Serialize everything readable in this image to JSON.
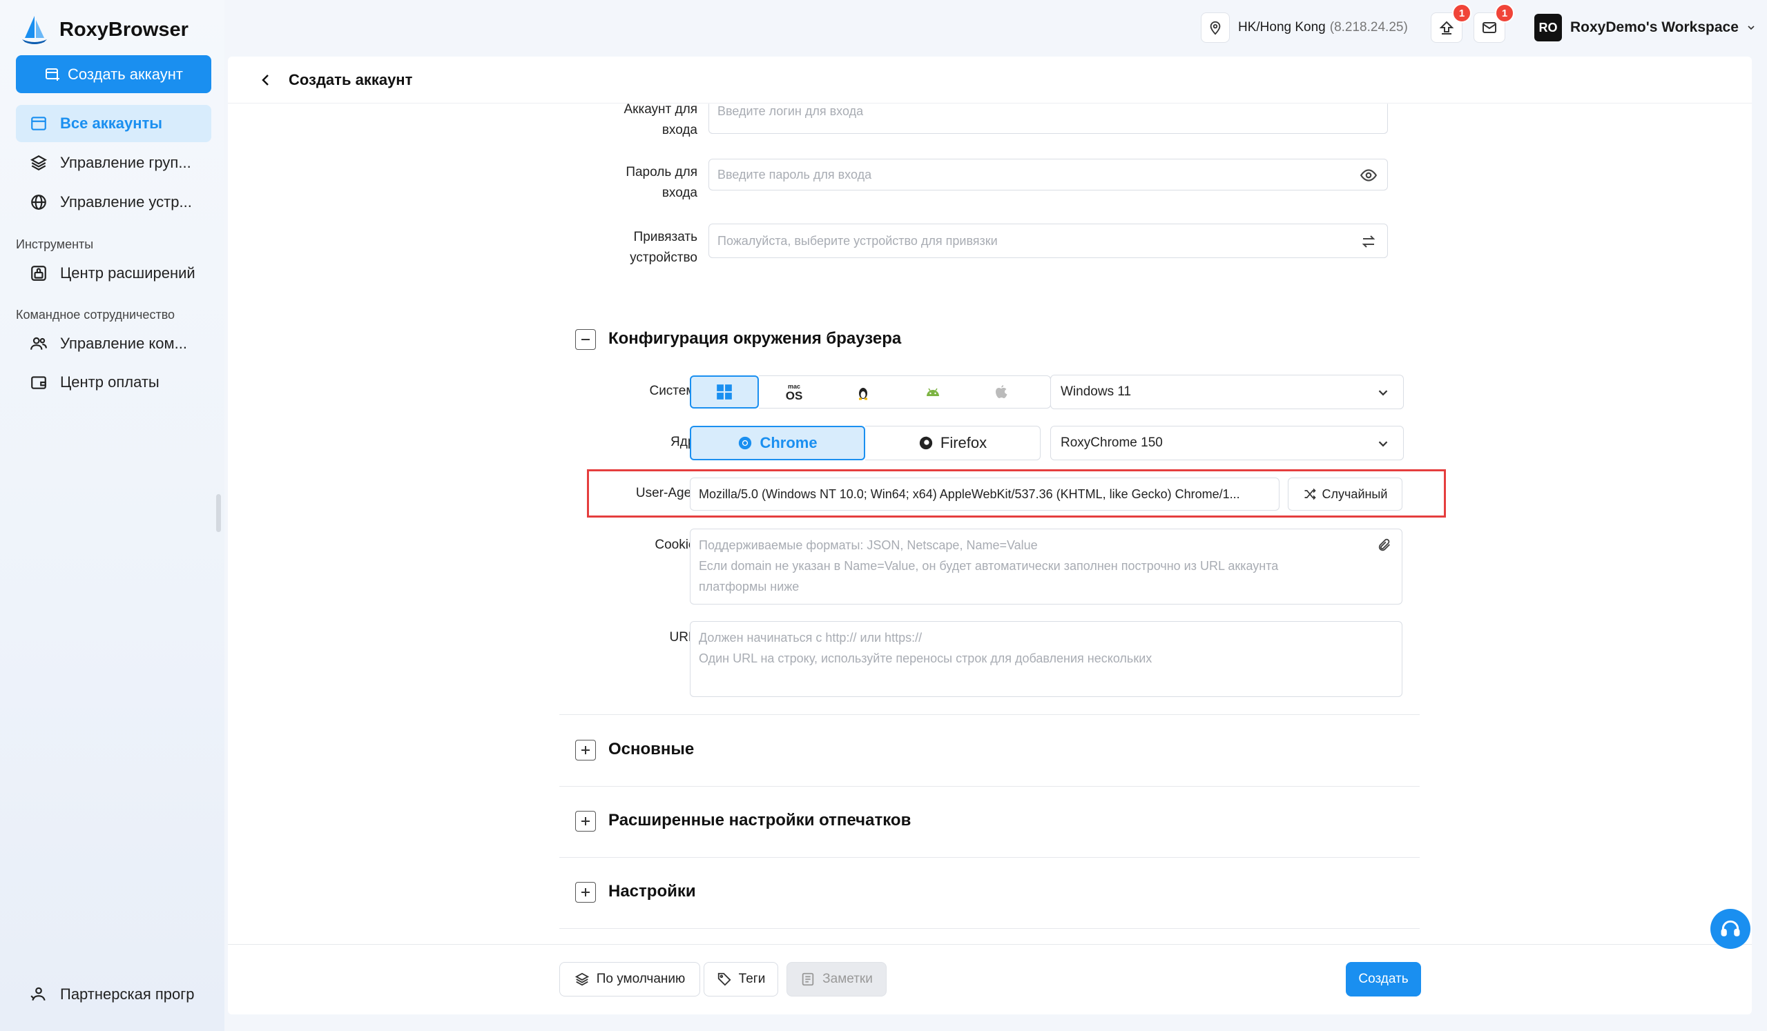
{
  "app": {
    "name": "RoxyBrowser"
  },
  "sidebar": {
    "create_button": "Создать аккаунт",
    "items": [
      {
        "label": "Все аккаунты"
      },
      {
        "label": "Управление груп..."
      },
      {
        "label": "Управление устр..."
      }
    ],
    "tools_section": "Инструменты",
    "tools_items": [
      {
        "label": "Центр расширений"
      }
    ],
    "team_section": "Командное сотрудничество",
    "team_items": [
      {
        "label": "Управление ком..."
      },
      {
        "label": "Центр оплаты"
      }
    ],
    "partner": "Партнерская прогр"
  },
  "topbar": {
    "location": "HK/Hong Kong",
    "ip": "(8.218.24.25)",
    "upload_badge": "1",
    "mail_badge": "1",
    "workspace_avatar": "RO",
    "workspace": "RoxyDemo's Workspace"
  },
  "page": {
    "title": "Создать аккаунт",
    "login_label_1": "Аккаунт для",
    "login_label_2": "входа",
    "login_placeholder": "Введите логин для входа",
    "password_label_1": "Пароль для",
    "password_label_2": "входа",
    "password_placeholder": "Введите пароль для входа",
    "device_label_1": "Привязать",
    "device_label_2": "устройство",
    "device_placeholder": "Пожалуйста, выберите устройство для привязки",
    "env_section": "Конфигурация окружения браузера",
    "system_label": "Система",
    "system_select": "Windows 11",
    "kernel_label": "Ядро",
    "kernel_chrome": "Chrome",
    "kernel_firefox": "Firefox",
    "kernel_select": "RoxyChrome 150",
    "ua_label": "User-Agent",
    "ua_value": "Mozilla/5.0 (Windows NT 10.0; Win64; x64) AppleWebKit/537.36 (KHTML, like Gecko) Chrome/1...",
    "ua_random": "Случайный",
    "cookies_label": "Cookies",
    "cookies_ph1": "Поддерживаемые форматы: JSON, Netscape, Name=Value",
    "cookies_ph2": "Если domain не указан в Name=Value, он будет автоматически заполнен построчно из URL аккаунта",
    "cookies_ph3": "платформы ниже",
    "urls_label": "URLs",
    "urls_ph1": "Должен начинаться с http:// или https://",
    "urls_ph2": "Один URL на строку, используйте переносы строк для добавления нескольких",
    "section_basic": "Основные",
    "section_fingerprint": "Расширенные настройки отпечатков",
    "section_settings": "Настройки"
  },
  "footer": {
    "default_button": "По умолчанию",
    "tags_button": "Теги",
    "notes_button": "Заметки",
    "create_button": "Создать"
  },
  "colors": {
    "accent": "#1a8ff0",
    "highlight": "#e53e3e",
    "badge": "#f04438"
  }
}
